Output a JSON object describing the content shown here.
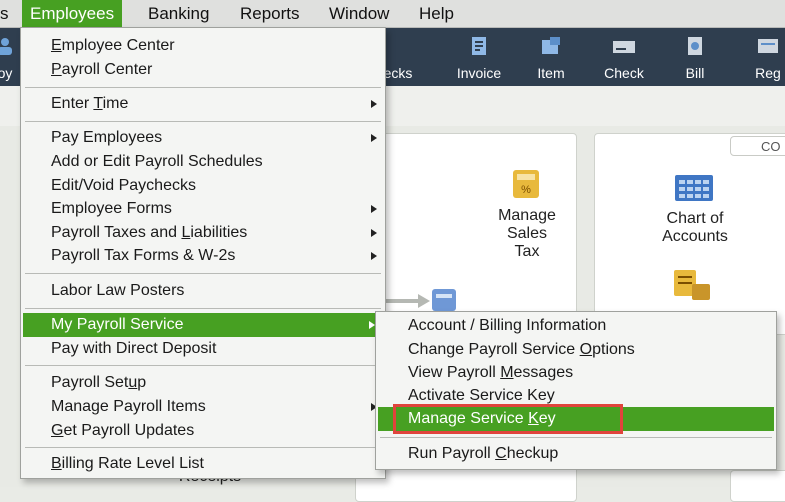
{
  "menubar": {
    "items": [
      {
        "label": "s"
      },
      {
        "label": "Employees"
      },
      {
        "label": "Banking"
      },
      {
        "label": "Reports"
      },
      {
        "label": "Window"
      },
      {
        "label": "Help"
      }
    ]
  },
  "toolbar": {
    "items": [
      {
        "label": "oy",
        "icon": "employees-icon"
      },
      {
        "label": "ecks",
        "icon": "checks-icon"
      },
      {
        "label": "Invoice",
        "icon": "invoice-icon"
      },
      {
        "label": "Item",
        "icon": "item-icon"
      },
      {
        "label": "Check",
        "icon": "check-icon"
      },
      {
        "label": "Bill",
        "icon": "bill-icon"
      },
      {
        "label": "Reg",
        "icon": "register-icon"
      }
    ]
  },
  "home": {
    "manage_sales_tax": "Manage\nSales\nTax",
    "chart_of_accounts": "Chart of\nAccounts",
    "top_right_button": "CO",
    "receipts_partial": "Receipts"
  },
  "employees_menu": {
    "groups": [
      [
        {
          "label": "Employee Center",
          "u": "E"
        },
        {
          "label": "Payroll Center",
          "u": "P"
        }
      ],
      [
        {
          "label": "Enter Time",
          "u": "T",
          "submenu": true
        }
      ],
      [
        {
          "label": "Pay Employees",
          "submenu": true
        },
        {
          "label": "Add or Edit Payroll Schedules"
        },
        {
          "label": "Edit/Void Paychecks"
        },
        {
          "label": "Employee Forms",
          "submenu": true
        },
        {
          "label": "Payroll Taxes and Liabilities",
          "submenu": true
        },
        {
          "label": "Payroll Tax Forms & W-2s",
          "submenu": true
        }
      ],
      [
        {
          "label": "Labor Law Posters"
        }
      ],
      [
        {
          "label": "My Payroll Service",
          "submenu": true,
          "highlighted": true
        },
        {
          "label": "Pay with Direct Deposit"
        }
      ],
      [
        {
          "label": "Payroll Setup"
        },
        {
          "label": "Manage Payroll Items",
          "submenu": true
        },
        {
          "label": "Get Payroll Updates"
        }
      ],
      [
        {
          "label": "Billing Rate Level List"
        }
      ]
    ]
  },
  "payroll_service_submenu": {
    "items": [
      {
        "label": "Account / Billing Information"
      },
      {
        "label": "Change Payroll Service Options"
      },
      {
        "label": "View Payroll Messages"
      },
      {
        "label": "Activate Service Key"
      },
      {
        "label": "Manage Service Key",
        "highlighted": true
      },
      {
        "label": "Run Payroll Checkup"
      }
    ]
  },
  "colors": {
    "accent_green": "#47a022",
    "toolbar_bg": "#2f3e4f",
    "highlight_box": "#e0443c"
  }
}
